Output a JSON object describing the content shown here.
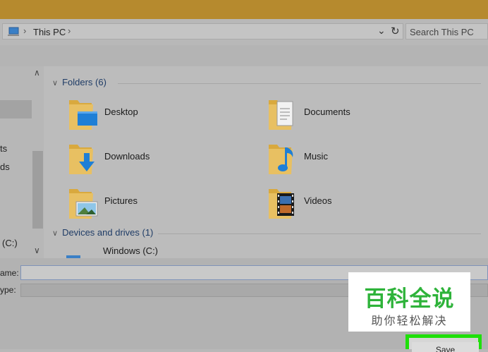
{
  "address_bar": {
    "icon": "this-pc-icon",
    "location": "This PC"
  },
  "search": {
    "placeholder": "Search This PC"
  },
  "nav_pane": {
    "items": [
      "ts",
      "ds",
      "(C:)"
    ]
  },
  "content": {
    "folders_header": "Folders (6)",
    "folders": [
      {
        "label": "Desktop",
        "icon": "desktop-folder-icon"
      },
      {
        "label": "Documents",
        "icon": "documents-folder-icon"
      },
      {
        "label": "Downloads",
        "icon": "downloads-folder-icon"
      },
      {
        "label": "Music",
        "icon": "music-folder-icon"
      },
      {
        "label": "Pictures",
        "icon": "pictures-folder-icon"
      },
      {
        "label": "Videos",
        "icon": "videos-folder-icon"
      }
    ],
    "devices_header": "Devices and drives (1)",
    "drives": [
      {
        "label": "Windows (C:)",
        "icon": "drive-icon"
      }
    ]
  },
  "bottom_panel": {
    "filename_label": "ame:",
    "filename_value": "",
    "savetype_label": "ype:",
    "save_label": "Save"
  },
  "watermark": {
    "title": "百科全说",
    "subtitle": "助你轻松解决",
    "color": "#2eb33a"
  },
  "colors": {
    "titlebar": "#b68a2e",
    "highlight": "#1fe00a",
    "folder": "#e8b84a",
    "accent_blue": "#1f7fd6"
  }
}
